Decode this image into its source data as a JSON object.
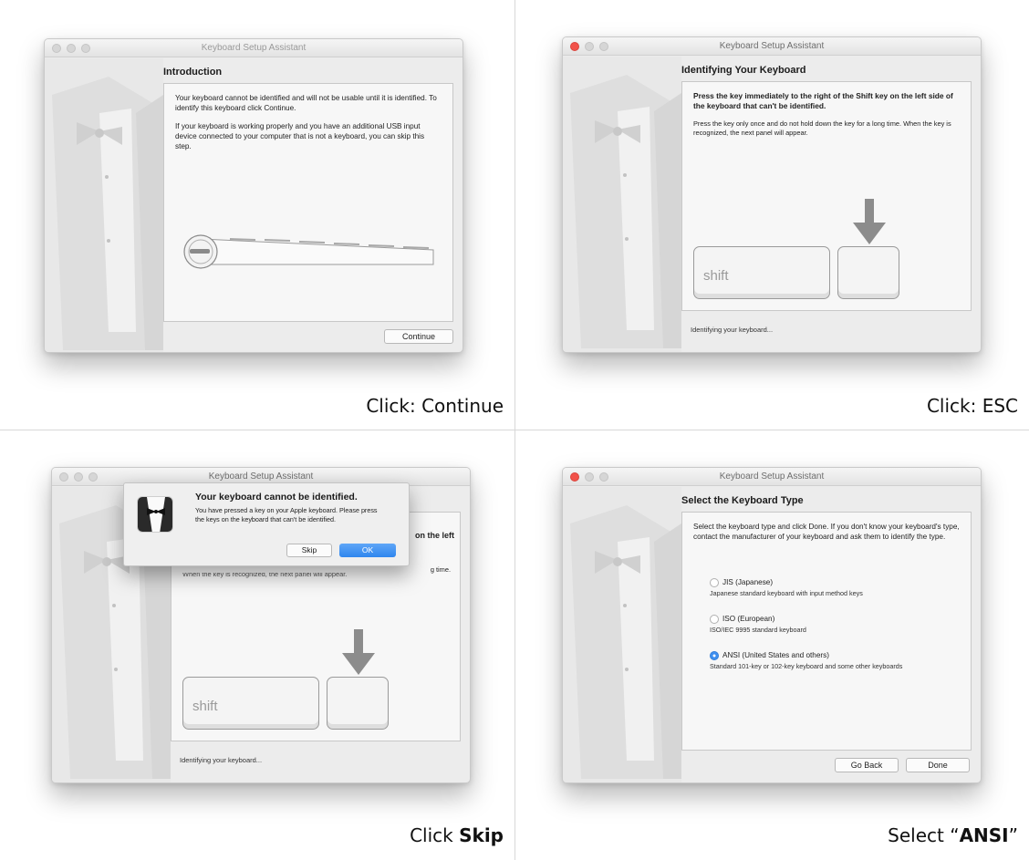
{
  "panels": [
    {
      "window_title": "Keyboard Setup Assistant",
      "heading": "Introduction",
      "paragraph1": "Your keyboard cannot be identified and will not be usable until it is identified. To identify this keyboard click Continue.",
      "paragraph2": "If your keyboard is working properly and you have an additional USB input device connected to your computer that is not a keyboard, you can skip this step.",
      "continue_label": "Continue",
      "caption": "Click: Continue"
    },
    {
      "window_title": "Keyboard Setup Assistant",
      "heading": "Identifying Your Keyboard",
      "instruction_bold": "Press the key immediately to the right of the Shift key on the left side of the keyboard that can't be identified.",
      "instruction": "Press the key only once and do not hold down the key for a long time. When the key is recognized, the next panel will appear.",
      "shift_label": "shift",
      "status": "Identifying your keyboard...",
      "caption": "Click:  ESC"
    },
    {
      "window_title": "Keyboard Setup Assistant",
      "alert_title": "Your keyboard cannot be identified.",
      "alert_message": "You have pressed a key on your Apple keyboard. Please press the keys on the keyboard that can't be identified.",
      "skip_label": "Skip",
      "ok_label": "OK",
      "behind_text_right": "on the left",
      "behind_text_time": "g time.",
      "behind_text_line": "When the key is recognized, the next panel will appear.",
      "shift_label": "shift",
      "status": "Identifying your keyboard...",
      "caption_prefix": "Click ",
      "caption_bold": "Skip"
    },
    {
      "window_title": "Keyboard Setup Assistant",
      "heading": "Select the Keyboard Type",
      "intro": "Select the keyboard type and click Done. If you don't know your keyboard's type, contact the manufacturer of your keyboard and ask them to identify the type.",
      "options": [
        {
          "label": "JIS (Japanese)",
          "desc": "Japanese standard keyboard with input method keys",
          "selected": false
        },
        {
          "label": "ISO (European)",
          "desc": "ISO/IEC 9995 standard keyboard",
          "selected": false
        },
        {
          "label": "ANSI (United States and others)",
          "desc": "Standard 101-key or 102-key keyboard and some other keyboards",
          "selected": true
        }
      ],
      "go_back_label": "Go Back",
      "done_label": "Done",
      "caption_prefix": "Select “",
      "caption_bold": "ANSI",
      "caption_suffix": "”"
    }
  ],
  "colors": {
    "accent": "#3b8ef0",
    "close_button": "#f2524a"
  },
  "icons": [
    "tuxedo-illustration",
    "keyboard-illustration",
    "down-arrow-icon",
    "bowtie-icon"
  ]
}
